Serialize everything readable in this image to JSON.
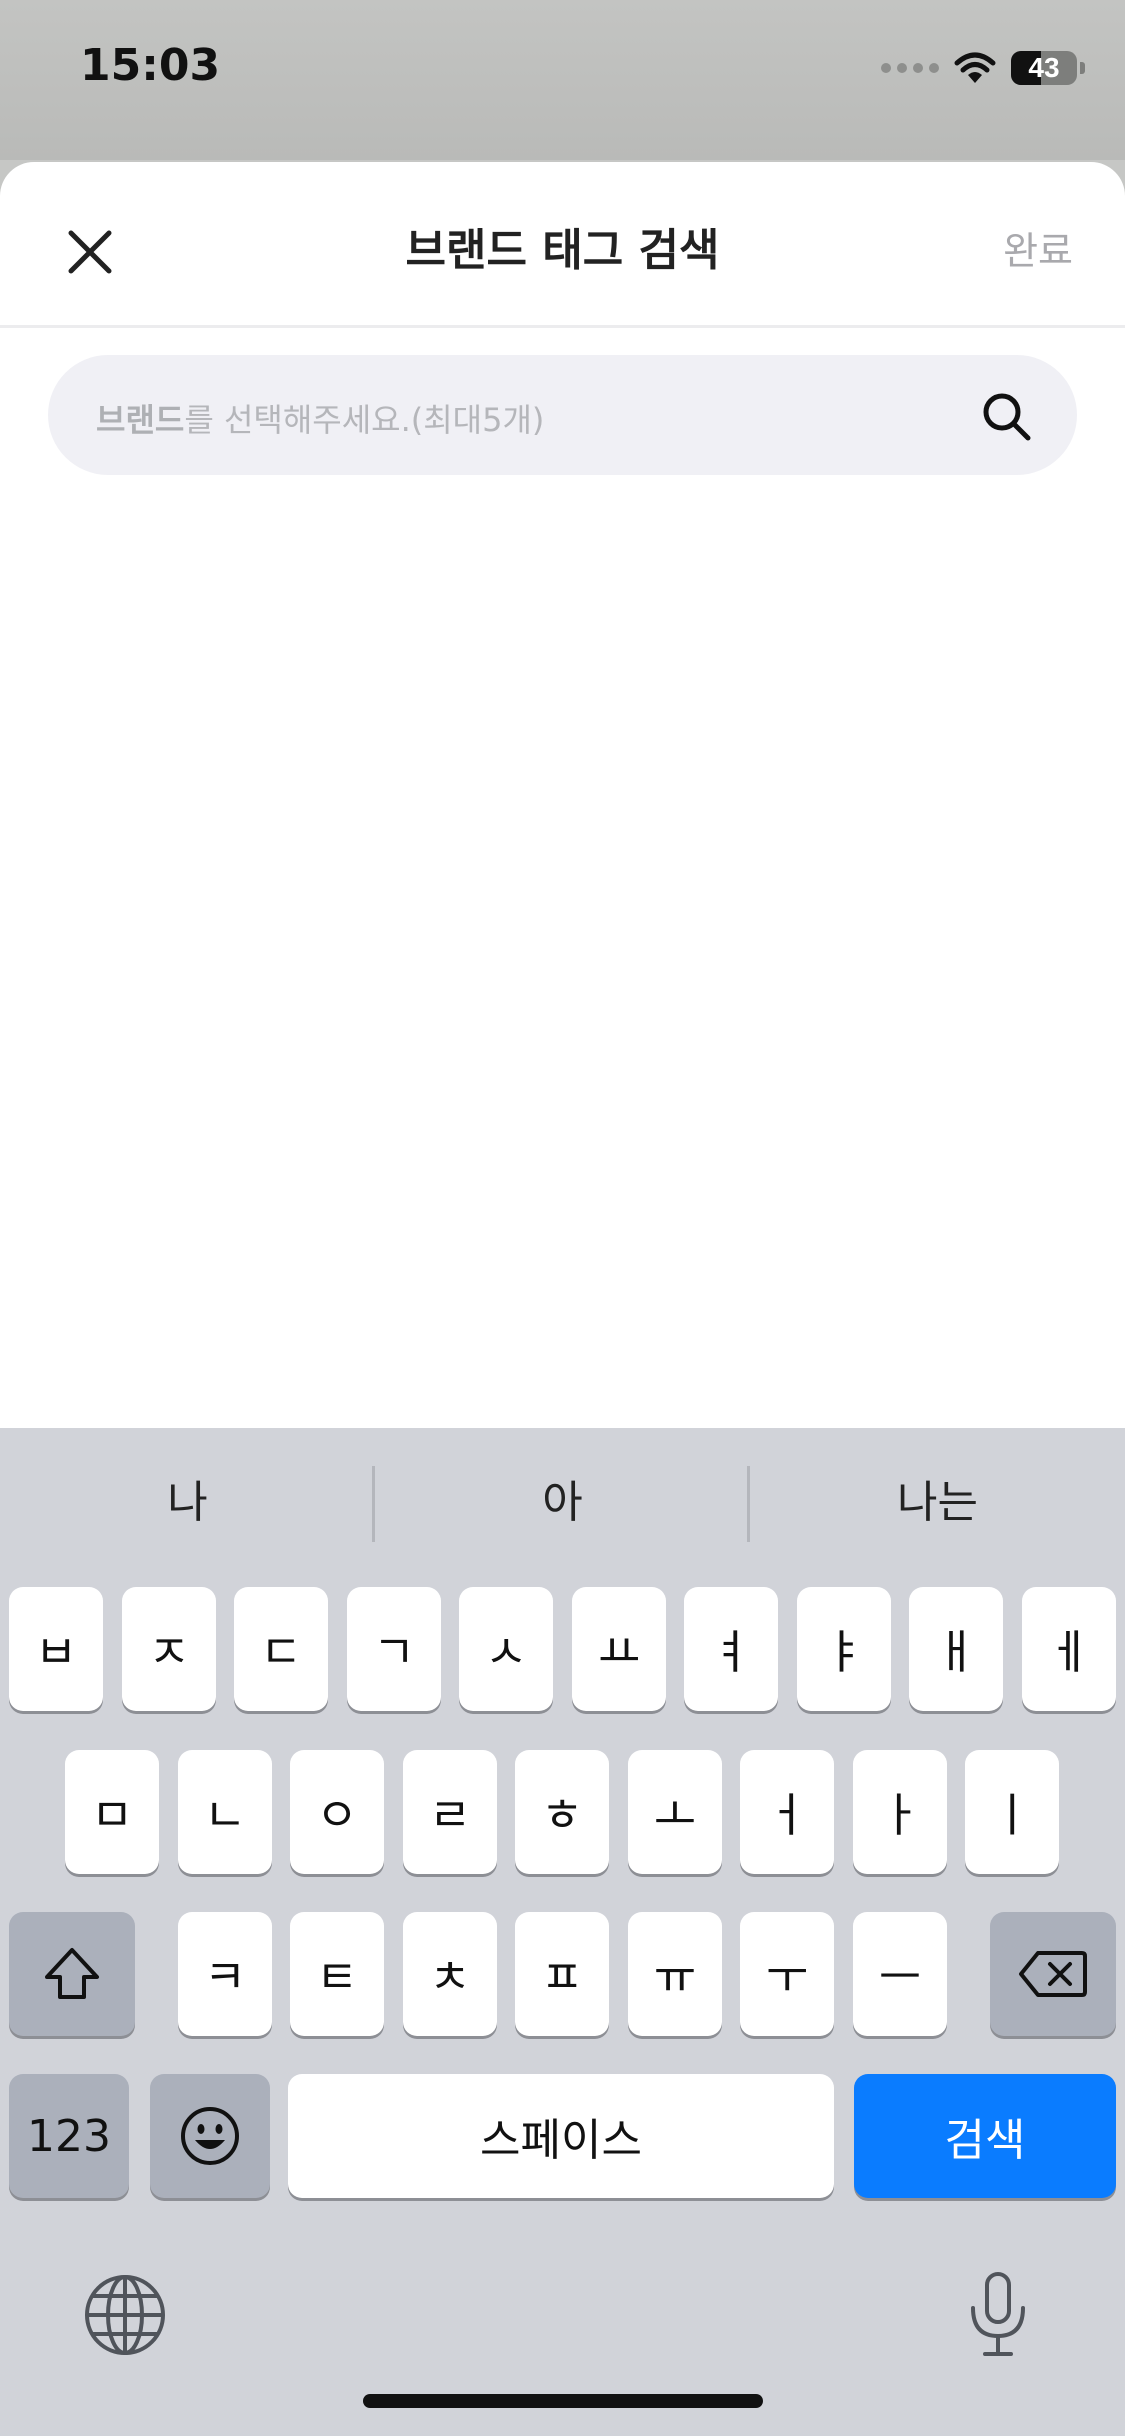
{
  "status_bar": {
    "time": "15:03",
    "battery": "43"
  },
  "header": {
    "title": "브랜드 태그 검색",
    "done_label": "완료"
  },
  "search": {
    "placeholder_bold": "브랜드",
    "placeholder_rest": "를 선택해주세요.(최대5개)"
  },
  "keyboard": {
    "suggestions": [
      "나",
      "아",
      "나는"
    ],
    "row1": [
      "ㅂ",
      "ㅈ",
      "ㄷ",
      "ㄱ",
      "ㅅ",
      "ㅛ",
      "ㅕ",
      "ㅑ",
      "ㅐ",
      "ㅔ"
    ],
    "row2": [
      "ㅁ",
      "ㄴ",
      "ㅇ",
      "ㄹ",
      "ㅎ",
      "ㅗ",
      "ㅓ",
      "ㅏ",
      "ㅣ"
    ],
    "row3": [
      "ㅋ",
      "ㅌ",
      "ㅊ",
      "ㅍ",
      "ㅠ",
      "ㅜ",
      "ㅡ"
    ],
    "numbers_label": "123",
    "space_label": "스페이스",
    "search_label": "검색",
    "accent_color": "#0a7cff"
  },
  "icons": [
    "close-icon",
    "search-icon",
    "shift-icon",
    "backspace-icon",
    "emoji-icon",
    "globe-icon",
    "microphone-icon",
    "wifi-icon",
    "battery-icon"
  ]
}
